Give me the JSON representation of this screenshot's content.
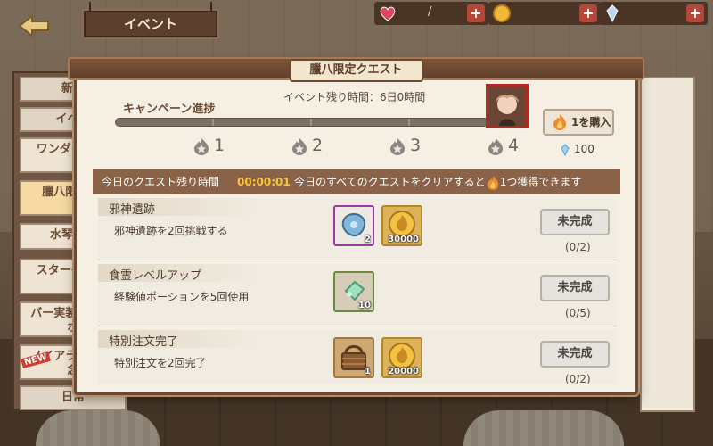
{
  "header": {
    "event_sign": "イベント",
    "resources": {
      "hearts": "/",
      "plus": "+"
    }
  },
  "left_menu": {
    "items": [
      {
        "label": "新米"
      },
      {
        "label": "イベン"
      },
      {
        "label": "ワンダー ゲー"
      },
      {
        "label": "臘八限定 ト"
      },
      {
        "label": "水琴の宴"
      },
      {
        "label": "スターゲ ギフ"
      },
      {
        "label": "バー実装 グインボ"
      },
      {
        "label": "ノイアラタ 告記念"
      },
      {
        "label": "日常"
      }
    ],
    "new_badge": "NEW"
  },
  "modal": {
    "title": "臘八限定クエスト",
    "campaign_label": "キャンペーン進捗",
    "time_left": "イベント残り時間：6日0時間",
    "campaign_progress": 0,
    "milestones": [
      "1",
      "2",
      "3",
      "4"
    ],
    "buy_button": "1を購入",
    "gem_cost": "100",
    "today_label": "今日のクエスト残り時間",
    "today_timer": "00:00:01",
    "today_info_prefix": "今日のすべてのクエストをクリアすると",
    "today_info_suffix": "1つ獲得できます",
    "quests": [
      {
        "title": "邪神遺跡",
        "description": "邪神遺跡を2回挑戦する",
        "rewards": [
          {
            "icon": "blue-crystal-icon",
            "qty": "2"
          },
          {
            "icon": "gold-coin-icon",
            "qty": "30000"
          }
        ],
        "status": "未完成",
        "progress": "(0/2)"
      },
      {
        "title": "食霊レベルアップ",
        "description": "経験値ポーションを5回使用",
        "rewards": [
          {
            "icon": "green-gem-icon",
            "qty": "10"
          }
        ],
        "status": "未完成",
        "progress": "(0/5)"
      },
      {
        "title": "特別注文完了",
        "description": "特別注文を2回完了",
        "rewards": [
          {
            "icon": "basket-icon",
            "qty": "1"
          },
          {
            "icon": "gold-coin-icon",
            "qty": "20000"
          }
        ],
        "status": "未完成",
        "progress": "(0/2)"
      }
    ]
  },
  "colors": {
    "accent_gold": "#f7c63c",
    "header_brown": "#8a6247",
    "avatar_border": "#b3281f"
  }
}
